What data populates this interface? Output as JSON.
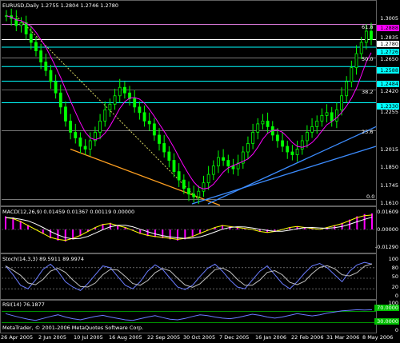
{
  "main": {
    "header": "EURUSD,Daily  1.2755 1.2804 1.2746 1.2780",
    "yticks": [
      "1.3005",
      "1.2835",
      "1.2650",
      "1.2420",
      "1.2255",
      "1.2015",
      "1.1850",
      "1.1745",
      "1.1610"
    ],
    "price_labels": [
      {
        "text": "1.2888",
        "bg": "#ff00ff",
        "fg": "#000"
      },
      {
        "text": "1.2780",
        "bg": "#ffffff",
        "fg": "#000"
      },
      {
        "text": "1.2726",
        "bg": "#00ffff",
        "fg": "#000"
      },
      {
        "text": "1.2588",
        "bg": "#00ffff",
        "fg": "#000"
      },
      {
        "text": "1.2484",
        "bg": "#00ffff",
        "fg": "#000"
      },
      {
        "text": "1.2330",
        "bg": "#00ffff",
        "fg": "#000"
      }
    ],
    "fib_labels": [
      "61.8",
      "50.0",
      "38.2",
      "23.6",
      "0.0"
    ]
  },
  "macd": {
    "header": "MACD(12,26,9) 0.01459 0.01367 0.00119 0.00000",
    "yticks": [
      "0.01609",
      "0.00000",
      "-0.01290"
    ]
  },
  "stoch": {
    "header": "Stoch(14,3,3) 89.5911 89.9974",
    "yticks": [
      "100",
      "80",
      "50",
      "20",
      "0"
    ]
  },
  "rsi": {
    "header": "RSI(14) 76.1877",
    "yticks": [
      "100",
      "70.0000",
      "30.0000",
      "0"
    ]
  },
  "footer": "MetaTrader, © 2001-2006 MetaQuotes Software Corp.",
  "xticks": [
    "26 Apr 2005",
    "2 Jun 2005",
    "10 Jul 2005",
    "16 Aug 2005",
    "22 Sep 2005",
    "30 Oct 2005",
    "7 Dec 2005",
    "16 Jan 2006",
    "22 Feb 2006",
    "31 Mar 2006",
    "8 May 2006"
  ],
  "colors": {
    "bull": "#00ff00",
    "bear": "#00ff00",
    "ma_fast": "#ff00ff",
    "ma_slow": "#ffffff",
    "fib_line": "#ffffff",
    "support": "#3c8cff",
    "orange": "#ffa020",
    "pink": "#ff00ff"
  },
  "chart_data": {
    "type": "candlestick",
    "symbol": "EURUSD",
    "timeframe": "Daily",
    "last_ohlc": {
      "open": 1.2755,
      "high": 1.2804,
      "low": 1.2746,
      "close": 1.278
    },
    "price_range": [
      1.161,
      1.3005
    ],
    "fib_levels": [
      {
        "label": "61.8",
        "price": 1.2888
      },
      {
        "label": "50.0",
        "price": 1.265
      },
      {
        "label": "38.2",
        "price": 1.242
      },
      {
        "label": "23.6",
        "price": 1.213
      },
      {
        "label": "0.0",
        "price": 1.164
      }
    ],
    "horizontal_levels": [
      1.2888,
      1.278,
      1.2726,
      1.2588,
      1.2484,
      1.233
    ],
    "close_series": [
      1.295,
      1.293,
      1.288,
      1.29,
      1.282,
      1.276,
      1.27,
      1.262,
      1.256,
      1.248,
      1.24,
      1.23,
      1.22,
      1.212,
      1.208,
      1.202,
      1.2,
      1.206,
      1.212,
      1.22,
      1.228,
      1.232,
      1.238,
      1.244,
      1.24,
      1.236,
      1.23,
      1.226,
      1.22,
      1.218,
      1.21,
      1.204,
      1.198,
      1.192,
      1.184,
      1.178,
      1.172,
      1.168,
      1.166,
      1.17,
      1.176,
      1.182,
      1.188,
      1.194,
      1.192,
      1.188,
      1.186,
      1.19,
      1.198,
      1.204,
      1.212,
      1.218,
      1.22,
      1.216,
      1.21,
      1.206,
      1.202,
      1.198,
      1.196,
      1.2,
      1.206,
      1.212,
      1.216,
      1.22,
      1.224,
      1.226,
      1.22,
      1.228,
      1.238,
      1.248,
      1.258,
      1.268,
      1.276,
      1.284,
      1.278
    ],
    "macd_values": [
      0.012,
      0.011,
      0.008,
      0.004,
      0.0,
      -0.004,
      -0.008,
      -0.01,
      -0.011,
      -0.009,
      -0.006,
      -0.002,
      0.002,
      0.005,
      0.006,
      0.004,
      0.002,
      -0.001,
      -0.004,
      -0.006,
      -0.007,
      -0.008,
      -0.009,
      -0.01,
      -0.009,
      -0.007,
      -0.004,
      -0.001,
      0.002,
      0.004,
      0.003,
      0.002,
      0.001,
      0.0,
      -0.002,
      -0.003,
      -0.002,
      0.0,
      0.002,
      0.003,
      0.002,
      0.001,
      0.0,
      0.002,
      0.004,
      0.006,
      0.009,
      0.012,
      0.014,
      0.0146
    ],
    "stoch_values": [
      85,
      60,
      30,
      20,
      45,
      75,
      90,
      70,
      40,
      25,
      15,
      35,
      60,
      85,
      80,
      55,
      30,
      20,
      40,
      70,
      88,
      75,
      50,
      25,
      18,
      30,
      55,
      78,
      90,
      70,
      45,
      25,
      20,
      45,
      70,
      85,
      60,
      35,
      20,
      40,
      65,
      85,
      92,
      80,
      60,
      40,
      70,
      88,
      95,
      90
    ],
    "rsi_values": [
      62,
      55,
      48,
      42,
      38,
      45,
      52,
      58,
      50,
      44,
      40,
      46,
      52,
      56,
      50,
      45,
      40,
      38,
      44,
      50,
      55,
      48,
      42,
      40,
      45,
      52,
      58,
      55,
      50,
      46,
      44,
      48,
      54,
      60,
      56,
      50,
      46,
      50,
      56,
      62,
      58,
      54,
      58,
      64,
      68,
      72,
      74,
      76,
      75,
      76
    ]
  }
}
